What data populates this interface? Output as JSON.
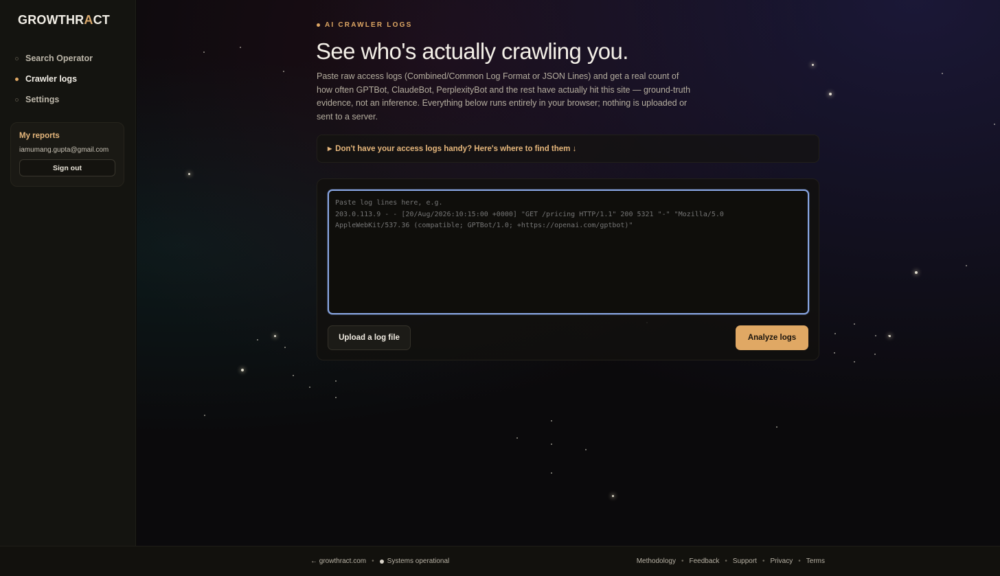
{
  "brand": {
    "logo_main": "GROWTHR",
    "logo_accent": "A",
    "logo_tail": "CT"
  },
  "sidebar": {
    "items": [
      {
        "label": "Search Operator",
        "active": false
      },
      {
        "label": "Crawler logs",
        "active": true
      },
      {
        "label": "Settings",
        "active": false
      }
    ],
    "reports": {
      "title": "My reports",
      "email": "iamumang.gupta@gmail.com",
      "signout_label": "Sign out"
    }
  },
  "main": {
    "eyebrow": "AI CRAWLER LOGS",
    "headline": "See who's actually crawling you.",
    "lede": "Paste raw access logs (Combined/Common Log Format or JSON Lines) and get a real count of how often GPTBot, ClaudeBot, PerplexityBot and the rest have actually hit this site — ground-truth evidence, not an inference. Everything below runs entirely in your browser; nothing is uploaded or sent to a server.",
    "disclosure": "Don't have your access logs handy? Here's where to find them ↓",
    "logbox": {
      "value": "",
      "placeholder": "Paste log lines here, e.g.\n203.0.113.9 - - [20/Aug/2026:10:15:00 +0000] \"GET /pricing HTTP/1.1\" 200 5321 \"-\" \"Mozilla/5.0 AppleWebKit/537.36 (compatible; GPTBot/1.0; +https://openai.com/gptbot)\""
    },
    "upload_label": "Upload a log file",
    "analyze_label": "Analyze logs"
  },
  "footer": {
    "back_link": "← growthract.com",
    "status": "Systems operational",
    "links": [
      "Methodology",
      "Feedback",
      "Support",
      "Privacy",
      "Terms"
    ]
  },
  "colors": {
    "accent": "#e0a864",
    "focus_ring": "#8aa8e6",
    "sidebar_bg": "#141410"
  },
  "icons": {
    "disclosure": "triangle-right-icon",
    "status": "status-dot-icon",
    "nav": "nav-dot-icon"
  }
}
